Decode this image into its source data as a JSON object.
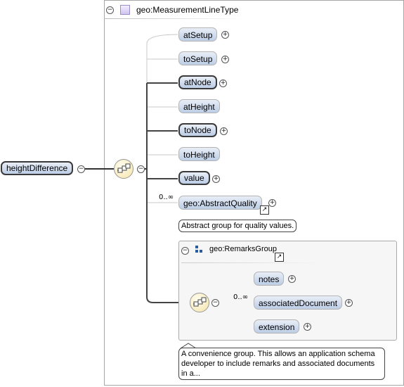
{
  "type_box": {
    "title": "geo:MeasurementLineType"
  },
  "root": {
    "label": "heightDifference"
  },
  "elements": [
    {
      "label": "atSetup"
    },
    {
      "label": "toSetup"
    },
    {
      "label": "atNode"
    },
    {
      "label": "atHeight"
    },
    {
      "label": "toNode"
    },
    {
      "label": "toHeight"
    },
    {
      "label": "value"
    },
    {
      "label": "geo:AbstractQuality",
      "cardinality": "0..∞",
      "doc": "Abstract group for quality values."
    }
  ],
  "group": {
    "title": "geo:RemarksGroup",
    "cardinality": "0..∞",
    "items": [
      {
        "label": "notes"
      },
      {
        "label": "associatedDocument"
      },
      {
        "label": "extension"
      }
    ],
    "doc": "A convenience group. This allows an application schema developer to include remarks and associated documents in a..."
  },
  "symbols": {
    "expand": "+",
    "collapse": "−",
    "link": "↗"
  },
  "colors": {
    "node_fill_top": "#e9eef7",
    "node_fill_bottom": "#bccde6",
    "sequence_fill": "#f4e4a8"
  }
}
